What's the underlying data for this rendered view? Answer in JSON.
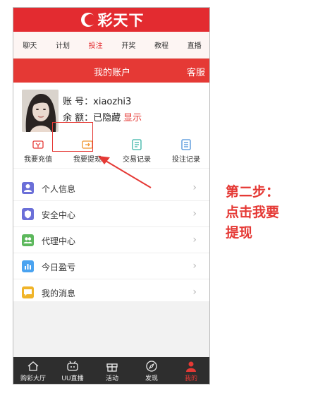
{
  "app": {
    "logo_text": "彩天下"
  },
  "nav": {
    "items": [
      "聊天",
      "计划",
      "投注",
      "开奖",
      "教程",
      "直播"
    ],
    "active_index": 2
  },
  "header": {
    "title": "我的账户",
    "action": "客服"
  },
  "account": {
    "account_label": "账 号：",
    "account_value": "xiaozhi3",
    "balance_label": "余 额：",
    "balance_value": "已隐藏",
    "balance_link": "显示"
  },
  "actions": [
    {
      "label": "我要充值",
      "icon": "deposit-icon"
    },
    {
      "label": "我要提现",
      "icon": "withdraw-icon"
    },
    {
      "label": "交易记录",
      "icon": "transaction-record-icon"
    },
    {
      "label": "投注记录",
      "icon": "bet-record-icon"
    }
  ],
  "menu": [
    {
      "label": "个人信息",
      "icon": "user-icon",
      "color": "#6b6fd8"
    },
    {
      "label": "安全中心",
      "icon": "shield-icon",
      "color": "#6b6fd8"
    },
    {
      "label": "代理中心",
      "icon": "agent-icon",
      "color": "#5cb85c"
    },
    {
      "label": "今日盈亏",
      "icon": "chart-icon",
      "color": "#4aa3f0"
    },
    {
      "label": "我的消息",
      "icon": "message-icon",
      "color": "#f0b429"
    }
  ],
  "tabs": [
    {
      "label": "购彩大厅",
      "icon": "home-icon"
    },
    {
      "label": "UU直播",
      "icon": "live-icon"
    },
    {
      "label": "活动",
      "icon": "gift-icon"
    },
    {
      "label": "发现",
      "icon": "compass-icon"
    },
    {
      "label": "我的",
      "icon": "person-icon"
    }
  ],
  "active_tab_index": 4,
  "annotation": {
    "line1": "第二步：",
    "line2": "点击我要",
    "line3": "提现"
  },
  "colors": {
    "brand_red": "#e32b30",
    "accent_red": "#e53935",
    "tabbar_dark": "#2e2e2e"
  }
}
